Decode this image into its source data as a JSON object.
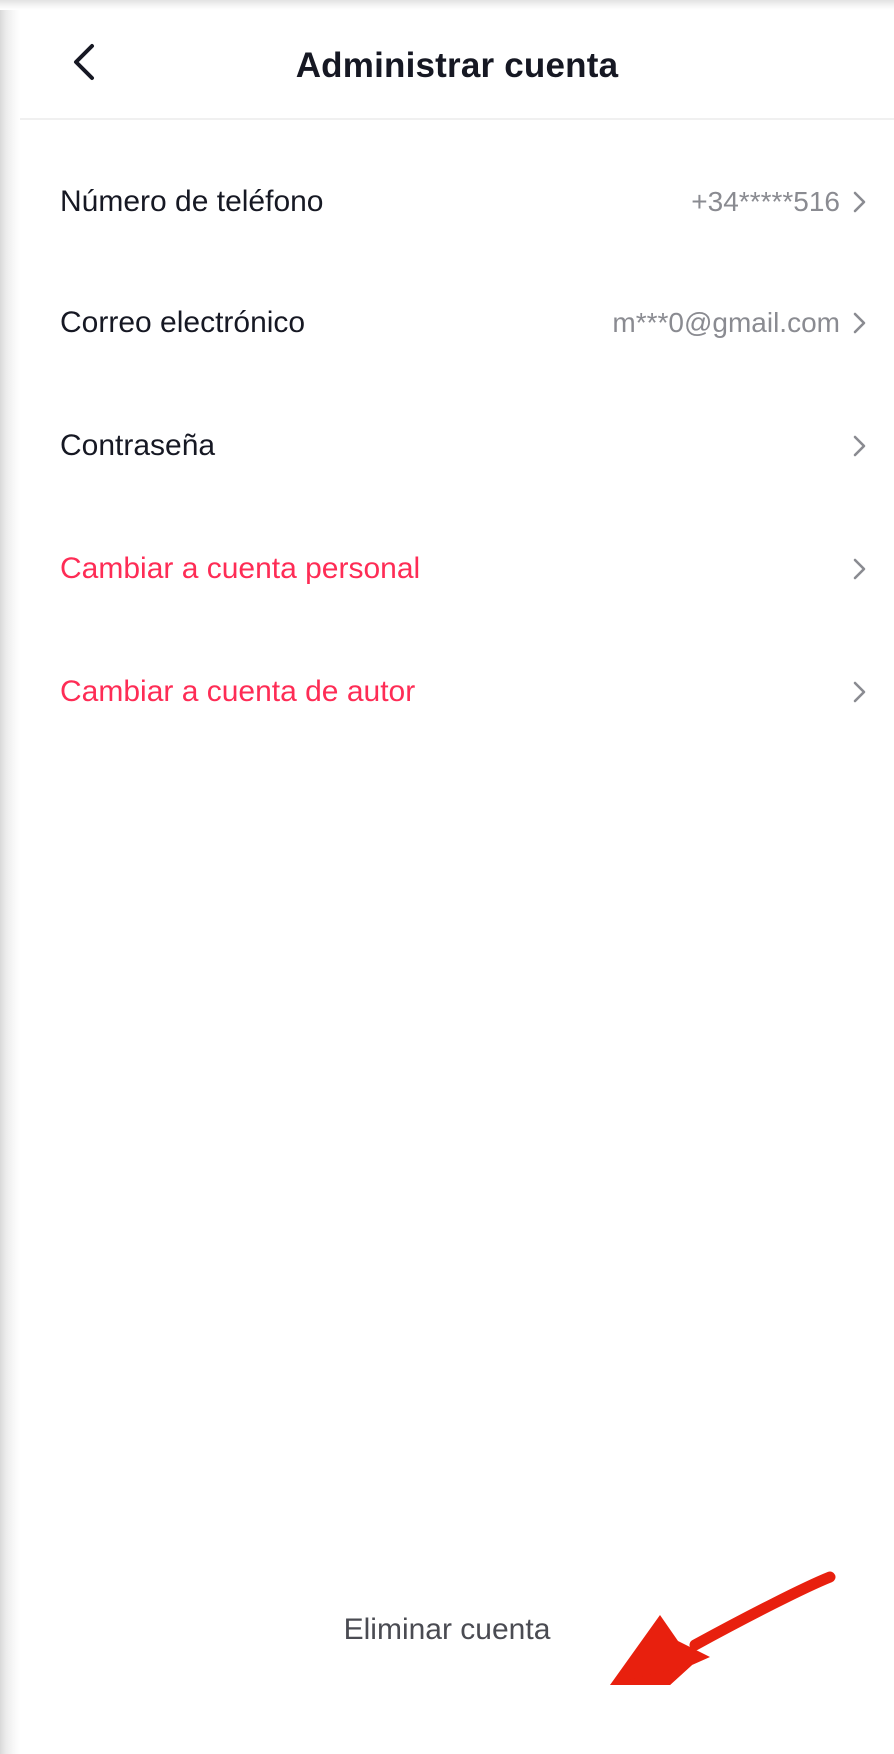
{
  "header": {
    "title": "Administrar cuenta",
    "back_icon": "chevron-left-icon"
  },
  "rows": [
    {
      "label": "Número de teléfono",
      "value": "+34*****516",
      "style": "normal"
    },
    {
      "label": "Correo electrónico",
      "value": "m***0@gmail.com",
      "style": "normal"
    },
    {
      "label": "Contraseña",
      "value": "",
      "style": "normal"
    },
    {
      "label": "Cambiar a cuenta personal",
      "value": "",
      "style": "danger"
    },
    {
      "label": "Cambiar a cuenta de autor",
      "value": "",
      "style": "danger"
    }
  ],
  "footer": {
    "delete_label": "Eliminar cuenta"
  },
  "colors": {
    "text": "#161823",
    "secondary_text": "#8a8b91",
    "danger": "#fe2c55",
    "annotation_arrow": "#e8200e"
  },
  "icons": {
    "row_chevron": "chevron-right-icon",
    "annotation": "red-arrow-annotation"
  }
}
